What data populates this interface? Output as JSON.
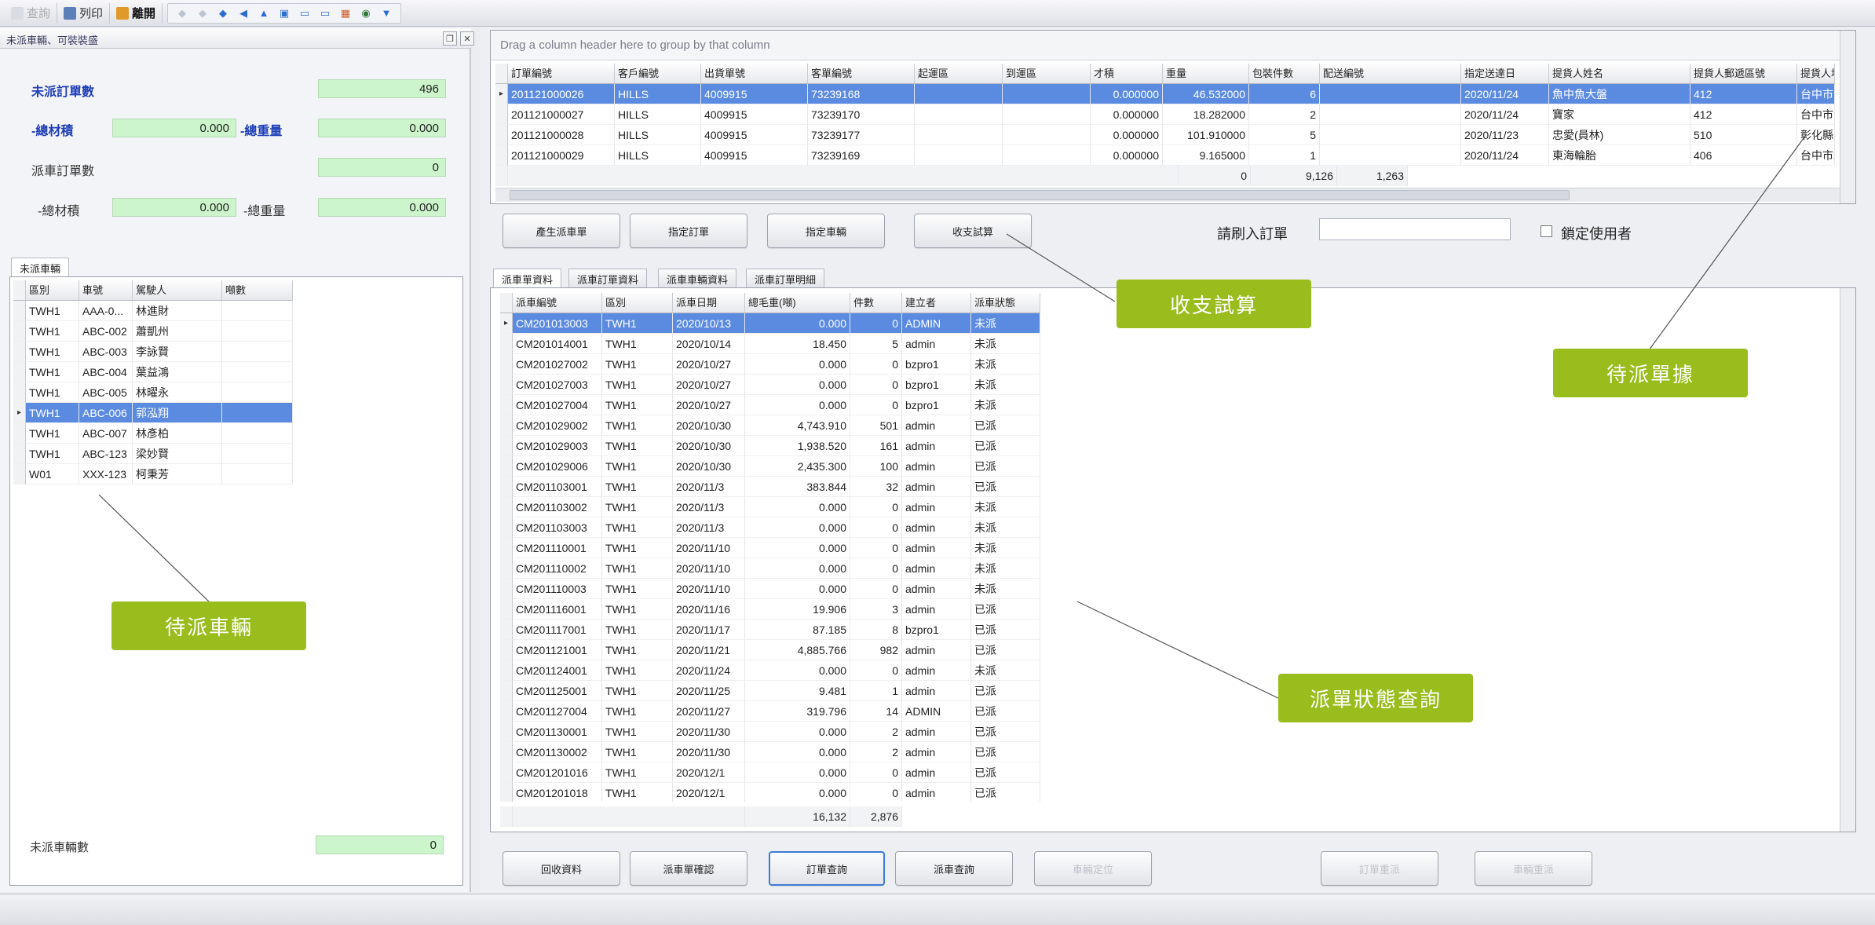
{
  "toolbar": {
    "query": "查詢",
    "print": "列印",
    "exit": "離開"
  },
  "left_panel": {
    "title": "未派車輛、可裝裝盛",
    "order_count_label": "未派訂單數",
    "order_count_value": "496",
    "total_volume_label": "-總材積",
    "total_volume_value": "0.000",
    "total_weight_label": "-總重量",
    "total_weight_value": "0.000",
    "dispatch_count_label": "派車訂單數",
    "dispatch_count_value": "0",
    "dispatch_volume_label": "-總材積",
    "dispatch_volume_value": "0.000",
    "dispatch_weight_label": "-總重量",
    "dispatch_weight_value": "0.000",
    "tab_label": "未派車輛",
    "vehicle_columns": [
      "區別",
      "車號",
      "駕駛人",
      "噸數"
    ],
    "vehicles": [
      {
        "area": "TWH1",
        "plate": "AAA-0...",
        "driver": "林進財",
        "tons": ""
      },
      {
        "area": "TWH1",
        "plate": "ABC-002",
        "driver": "蕭凱州",
        "tons": ""
      },
      {
        "area": "TWH1",
        "plate": "ABC-003",
        "driver": "李詠賢",
        "tons": ""
      },
      {
        "area": "TWH1",
        "plate": "ABC-004",
        "driver": "葉益鴻",
        "tons": ""
      },
      {
        "area": "TWH1",
        "plate": "ABC-005",
        "driver": "林曜永",
        "tons": ""
      },
      {
        "area": "TWH1",
        "plate": "ABC-006",
        "driver": "郭泓翔",
        "tons": ""
      },
      {
        "area": "TWH1",
        "plate": "ABC-007",
        "driver": "林彥柏",
        "tons": ""
      },
      {
        "area": "TWH1",
        "plate": "ABC-123",
        "driver": "梁妙賢",
        "tons": ""
      },
      {
        "area": "W01",
        "plate": "XXX-123",
        "driver": "柯秉芳",
        "tons": ""
      }
    ],
    "unassigned_vehicle_label": "未派車輛數",
    "unassigned_vehicle_value": "0"
  },
  "orders_grid": {
    "group_hint": "Drag a column header here to group by that column",
    "columns": [
      "訂單編號",
      "客戶編號",
      "出貨單號",
      "客單編號",
      "起運區",
      "到運區",
      "才積",
      "重量",
      "包裝件數",
      "配送編號",
      "指定送達日",
      "提貨人姓名",
      "提貨人郵遞區號",
      "提貨人地"
    ],
    "rows": [
      [
        "201121000026",
        "HILLS",
        "4009915",
        "73239168",
        "",
        "",
        "0.000000",
        "46.532000",
        "6",
        "",
        "2020/11/24",
        "魚中魚大盤",
        "412",
        "台中市大"
      ],
      [
        "201121000027",
        "HILLS",
        "4009915",
        "73239170",
        "",
        "",
        "0.000000",
        "18.282000",
        "2",
        "",
        "2020/11/24",
        "寶家",
        "412",
        "台中市大"
      ],
      [
        "201121000028",
        "HILLS",
        "4009915",
        "73239177",
        "",
        "",
        "0.000000",
        "101.910000",
        "5",
        "",
        "2020/11/23",
        "忠愛(員林)",
        "510",
        "彰化縣員"
      ],
      [
        "201121000029",
        "HILLS",
        "4009915",
        "73239169",
        "",
        "",
        "0.000000",
        "9.165000",
        "1",
        "",
        "2020/11/24",
        "東海輪胎",
        "406",
        "台中市北"
      ]
    ],
    "totals": [
      "0",
      "9,126",
      "1,263"
    ]
  },
  "action_buttons": {
    "create_dispatch": "產生派車單",
    "assign_order": "指定訂單",
    "assign_vehicle": "指定車輛",
    "trial_calc": "收支試算",
    "scan_label": "請刷入訂單",
    "lock_user": "鎖定使用者"
  },
  "dispatch_tabs": [
    "派車單資料",
    "派車訂單資料",
    "派車車輛資料",
    "派車訂單明細"
  ],
  "dispatch_grid": {
    "columns": [
      "派車編號",
      "區別",
      "派車日期",
      "總毛重(噸)",
      "件數",
      "建立者",
      "派車狀態"
    ],
    "rows": [
      [
        "CM201013003",
        "TWH1",
        "2020/10/13",
        "0.000",
        "0",
        "ADMIN",
        "未派"
      ],
      [
        "CM201014001",
        "TWH1",
        "2020/10/14",
        "18.450",
        "5",
        "admin",
        "未派"
      ],
      [
        "CM201027002",
        "TWH1",
        "2020/10/27",
        "0.000",
        "0",
        "bzpro1",
        "未派"
      ],
      [
        "CM201027003",
        "TWH1",
        "2020/10/27",
        "0.000",
        "0",
        "bzpro1",
        "未派"
      ],
      [
        "CM201027004",
        "TWH1",
        "2020/10/27",
        "0.000",
        "0",
        "bzpro1",
        "未派"
      ],
      [
        "CM201029002",
        "TWH1",
        "2020/10/30",
        "4,743.910",
        "501",
        "admin",
        "已派"
      ],
      [
        "CM201029003",
        "TWH1",
        "2020/10/30",
        "1,938.520",
        "161",
        "admin",
        "已派"
      ],
      [
        "CM201029006",
        "TWH1",
        "2020/10/30",
        "2,435.300",
        "100",
        "admin",
        "已派"
      ],
      [
        "CM201103001",
        "TWH1",
        "2020/11/3",
        "383.844",
        "32",
        "admin",
        "已派"
      ],
      [
        "CM201103002",
        "TWH1",
        "2020/11/3",
        "0.000",
        "0",
        "admin",
        "未派"
      ],
      [
        "CM201103003",
        "TWH1",
        "2020/11/3",
        "0.000",
        "0",
        "admin",
        "未派"
      ],
      [
        "CM201110001",
        "TWH1",
        "2020/11/10",
        "0.000",
        "0",
        "admin",
        "未派"
      ],
      [
        "CM201110002",
        "TWH1",
        "2020/11/10",
        "0.000",
        "0",
        "admin",
        "未派"
      ],
      [
        "CM201110003",
        "TWH1",
        "2020/11/10",
        "0.000",
        "0",
        "admin",
        "未派"
      ],
      [
        "CM201116001",
        "TWH1",
        "2020/11/16",
        "19.906",
        "3",
        "admin",
        "已派"
      ],
      [
        "CM201117001",
        "TWH1",
        "2020/11/17",
        "87.185",
        "8",
        "bzpro1",
        "已派"
      ],
      [
        "CM201121001",
        "TWH1",
        "2020/11/21",
        "4,885.766",
        "982",
        "admin",
        "已派"
      ],
      [
        "CM201124001",
        "TWH1",
        "2020/11/24",
        "0.000",
        "0",
        "admin",
        "未派"
      ],
      [
        "CM201125001",
        "TWH1",
        "2020/11/25",
        "9.481",
        "1",
        "admin",
        "已派"
      ],
      [
        "CM201127004",
        "TWH1",
        "2020/11/27",
        "319.796",
        "14",
        "ADMIN",
        "已派"
      ],
      [
        "CM201130001",
        "TWH1",
        "2020/11/30",
        "0.000",
        "2",
        "admin",
        "已派"
      ],
      [
        "CM201130002",
        "TWH1",
        "2020/11/30",
        "0.000",
        "2",
        "admin",
        "已派"
      ],
      [
        "CM201201016",
        "TWH1",
        "2020/12/1",
        "0.000",
        "0",
        "admin",
        "已派"
      ],
      [
        "CM201201018",
        "TWH1",
        "2020/12/1",
        "0.000",
        "0",
        "admin",
        "已派"
      ]
    ],
    "totals": [
      "16,132",
      "2,876"
    ]
  },
  "bottom_buttons": {
    "return_data": "回收資料",
    "dispatch_confirm": "派車單確認",
    "order_query": "訂單查詢",
    "dispatch_query": "派車查詢",
    "vehicle_position": "車輛定位",
    "order_redispatch": "訂單重派",
    "vehicle_redispatch": "車輛重派"
  },
  "callouts": {
    "trial_calc": "收支試算",
    "pending_docs": "待派單據",
    "pending_vehicles": "待派車輛",
    "dispatch_status": "派單狀態查詢"
  }
}
